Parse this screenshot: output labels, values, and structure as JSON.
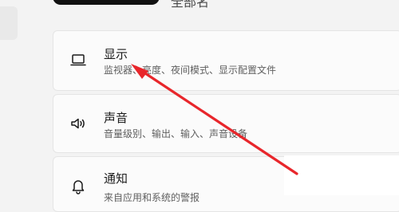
{
  "top_item": {
    "text": "全部名"
  },
  "settings": [
    {
      "icon": "monitor-icon",
      "title": "显示",
      "subtitle": "监视器、亮度、夜间模式、显示配置文件"
    },
    {
      "icon": "speaker-icon",
      "title": "声音",
      "subtitle": "音量级别、输出、输入、声音设备"
    },
    {
      "icon": "bell-icon",
      "title": "通知",
      "subtitle": "来自应用和系统的警报"
    }
  ],
  "annotation": {
    "arrow_color": "#e8262b"
  }
}
